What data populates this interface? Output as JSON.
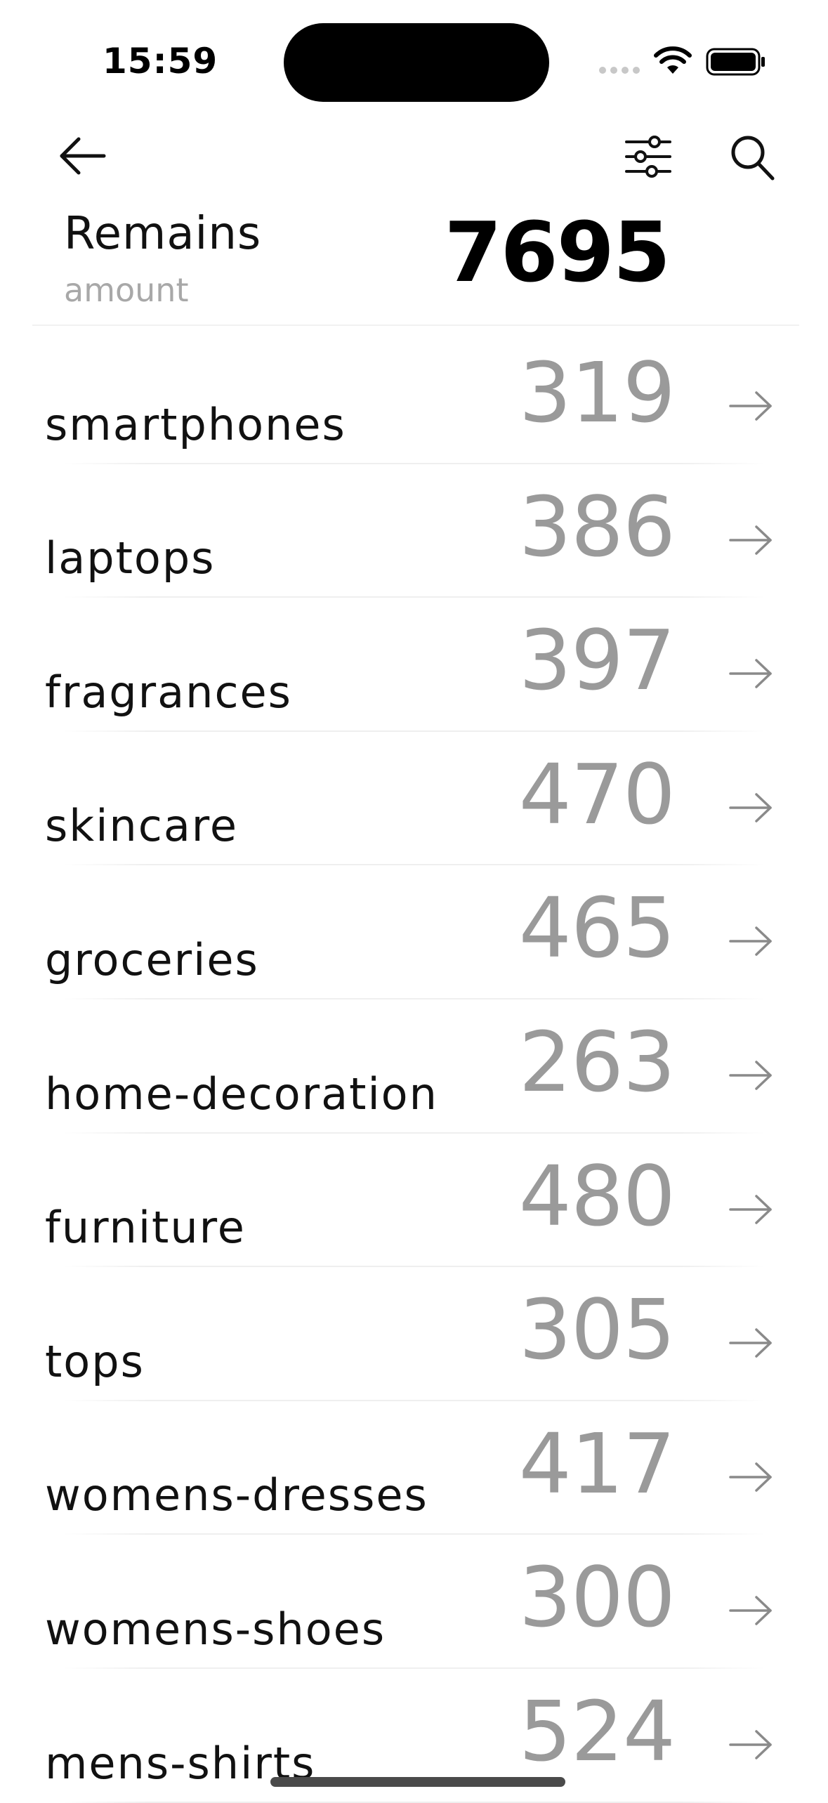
{
  "status_bar": {
    "time": "15:59"
  },
  "icons": {
    "back": "arrow-left-icon",
    "filter": "sliders-icon",
    "search": "search-icon",
    "row_arrow": "arrow-right-icon"
  },
  "summary": {
    "title": "Remains",
    "subtitle": "amount",
    "value": "7695"
  },
  "categories": [
    {
      "label": "smartphones",
      "count": "319"
    },
    {
      "label": "laptops",
      "count": "386"
    },
    {
      "label": "fragrances",
      "count": "397"
    },
    {
      "label": "skincare",
      "count": "470"
    },
    {
      "label": "groceries",
      "count": "465"
    },
    {
      "label": "home-decoration",
      "count": "263"
    },
    {
      "label": "furniture",
      "count": "480"
    },
    {
      "label": "tops",
      "count": "305"
    },
    {
      "label": "womens-dresses",
      "count": "417"
    },
    {
      "label": "womens-shoes",
      "count": "300"
    },
    {
      "label": "mens-shirts",
      "count": "524"
    }
  ],
  "colors": {
    "label": "#111111",
    "count": "#9a9a9a",
    "subtitle": "#a8a8a8",
    "arrow": "#8a8a8a"
  }
}
